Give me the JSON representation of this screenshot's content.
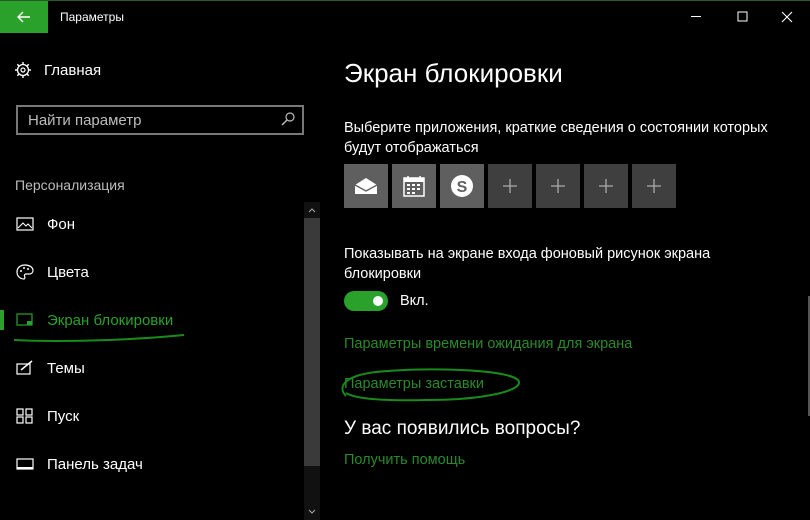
{
  "window": {
    "title": "Параметры"
  },
  "sidebar": {
    "home_label": "Главная",
    "search_placeholder": "Найти параметр",
    "section_title": "Персонализация",
    "items": [
      {
        "label": "Фон",
        "icon": "picture-icon",
        "active": false
      },
      {
        "label": "Цвета",
        "icon": "palette-icon",
        "active": false
      },
      {
        "label": "Экран блокировки",
        "icon": "lock-screen-icon",
        "active": true
      },
      {
        "label": "Темы",
        "icon": "themes-icon",
        "active": false
      },
      {
        "label": "Пуск",
        "icon": "start-icon",
        "active": false
      },
      {
        "label": "Панель задач",
        "icon": "taskbar-icon",
        "active": false
      }
    ]
  },
  "main": {
    "title": "Экран блокировки",
    "apps_description": "Выберите приложения, краткие сведения о состоянии которых будут отображаться",
    "apps": [
      {
        "icon": "mail-icon"
      },
      {
        "icon": "calendar-icon"
      },
      {
        "icon": "skype-icon"
      },
      {
        "icon": "plus-icon"
      },
      {
        "icon": "plus-icon"
      },
      {
        "icon": "plus-icon"
      },
      {
        "icon": "plus-icon"
      }
    ],
    "background_setting_label": "Показывать на экране входа фоновый рисунок экрана блокировки",
    "toggle_state": "Вкл.",
    "screen_timeout_link": "Параметры времени ожидания для экрана",
    "screensaver_link": "Параметры заставки",
    "questions_title": "У вас появились вопросы?",
    "help_link": "Получить помощь"
  },
  "colors": {
    "accent": "#2aa12a",
    "background": "#000000"
  }
}
